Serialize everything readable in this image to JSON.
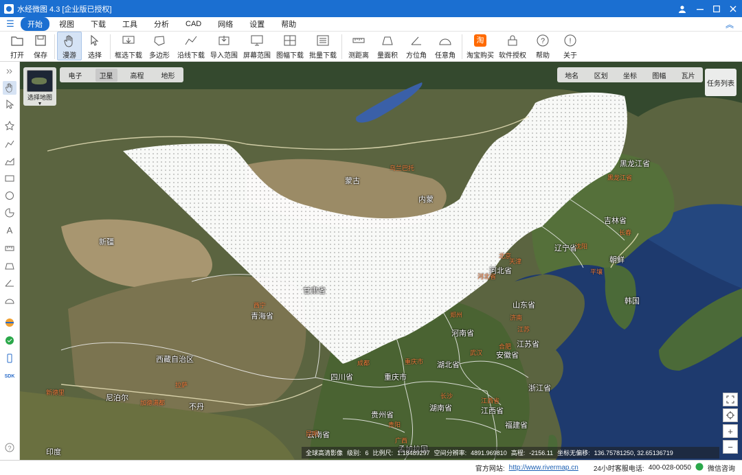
{
  "app": {
    "title": "水经微图 4.3 [企业版已授权]"
  },
  "menu": {
    "items": [
      "开始",
      "视图",
      "下载",
      "工具",
      "分析",
      "CAD",
      "网络",
      "设置",
      "帮助"
    ]
  },
  "toolbar": {
    "items": [
      "打开",
      "保存",
      "漫游",
      "选择",
      "框选下载",
      "多边形",
      "沿线下载",
      "导入范围",
      "屏幕范围",
      "图幅下载",
      "批量下载",
      "测距离",
      "量面积",
      "方位角",
      "任意角",
      "淘宝购买",
      "软件授权",
      "帮助",
      "关于"
    ]
  },
  "map": {
    "select_label": "选择地图",
    "types": [
      "电子",
      "卫星",
      "高程",
      "地形"
    ],
    "active_type": "卫星",
    "layers": [
      "地名",
      "区划",
      "坐标",
      "图幅",
      "瓦片"
    ],
    "task_list": "任务列表",
    "place_labels": [
      "黑龙江省",
      "吉林省",
      "辽宁省",
      "朝鲜",
      "韩国",
      "蒙古",
      "内蒙",
      "新疆",
      "青海省",
      "西藏自治区",
      "尼泊尔",
      "不丹",
      "印度",
      "四川省",
      "重庆市",
      "河南省",
      "山东省",
      "安徽省",
      "江苏省",
      "湖北省",
      "湖南省",
      "浙江省",
      "江西省",
      "福建省",
      "贵州省",
      "云南省",
      "河北省",
      "甘肃省",
      "孟加拉国"
    ],
    "capital_labels": [
      "乌兰巴托",
      "黑龙江省",
      "长春",
      "沈阳",
      "平壤",
      "北京",
      "天津",
      "河北省",
      "济南",
      "郑州",
      "西宁",
      "拉萨",
      "加德满都",
      "新德里",
      "成都",
      "重庆市",
      "武汉",
      "合肥",
      "江苏",
      "长沙",
      "江西省",
      "贵阳",
      "昆明",
      "广西"
    ]
  },
  "info": {
    "source": "全球高清影像",
    "level_label": "级别:",
    "level": "6",
    "scale_label": "比例尺:",
    "scale": "1:18489297",
    "resolution_label": "空间分辨率:",
    "resolution": "4891.969810",
    "elevation_label": "高程:",
    "elevation": "-2156.11",
    "coord_label": "坐标无偏移:",
    "coord": "136.75781250, 32.65136719"
  },
  "status": {
    "website_label": "官方网站:",
    "website": "http://www.rivermap.cn",
    "hotline_label": "24小时客服电话:",
    "hotline": "400-028-0050",
    "wechat": "微信咨询"
  },
  "colors": {
    "accent": "#1b6fd1",
    "title_bar": "#1b6fd1"
  }
}
